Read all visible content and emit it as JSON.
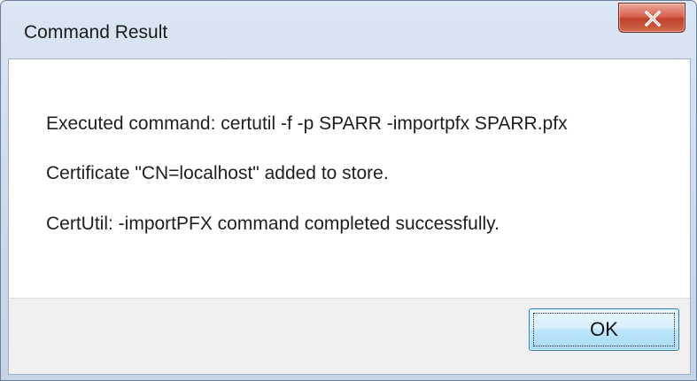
{
  "window": {
    "title": "Command Result"
  },
  "titlebar": {
    "close_icon": "close-icon"
  },
  "message": {
    "lines": [
      "Executed command: certutil -f -p SPARR -importpfx SPARR.pfx",
      "Certificate \"CN=localhost\" added to store.",
      "CertUtil: -importPFX command completed successfully."
    ]
  },
  "footer": {
    "ok_label": "OK"
  },
  "colors": {
    "close_button": "#c2412c",
    "ok_button": "#a7d9f5",
    "footer_bg": "#f0f0f0"
  }
}
